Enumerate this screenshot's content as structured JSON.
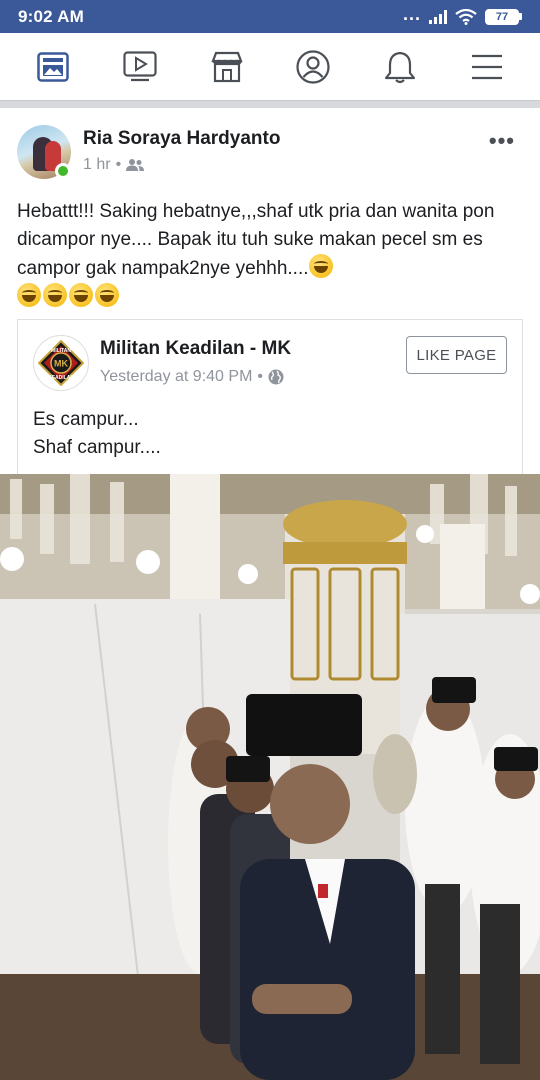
{
  "status_bar": {
    "time": "9:02 AM",
    "dots": "...",
    "battery": "77"
  },
  "nav": {
    "items": [
      {
        "name": "news-feed",
        "icon": "news-feed-icon",
        "active": true
      },
      {
        "name": "watch",
        "icon": "video-play-icon"
      },
      {
        "name": "marketplace",
        "icon": "store-icon"
      },
      {
        "name": "profile",
        "icon": "profile-icon"
      },
      {
        "name": "notifications",
        "icon": "bell-icon"
      },
      {
        "name": "menu",
        "icon": "hamburger-menu-icon"
      }
    ],
    "active_color": "#3b5998",
    "inactive_color": "#4b4f56"
  },
  "post": {
    "author": "Ria Soraya Hardyanto",
    "time": "1 hr",
    "separator": "•",
    "audience_icon": "friends-icon",
    "more_label": "•••",
    "text": "Hebattt!!! Saking hebatnye,,,shaf utk pria dan wanita pon dicampor nye.... Bapak itu tuh suke makan pecel sm es campor gak nampak2nye yehhh....",
    "emoji": "grinning-face-emoji",
    "emoji_count": 5
  },
  "shared_post": {
    "page_name": "Militan Keadilan - MK",
    "time": "Yesterday at 9:40 PM",
    "separator": "•",
    "audience_icon": "globe-icon",
    "logo_text_top": "MILITAN",
    "logo_text_mid": "MK",
    "logo_text_bottom": "KEADILAN",
    "like_button": "LIKE PAGE",
    "line1": "Es campur...",
    "line2": "Shaf campur...."
  },
  "colors": {
    "facebook_blue": "#3b5998",
    "online_green": "#42b72a",
    "meta_gray": "#90949c"
  }
}
